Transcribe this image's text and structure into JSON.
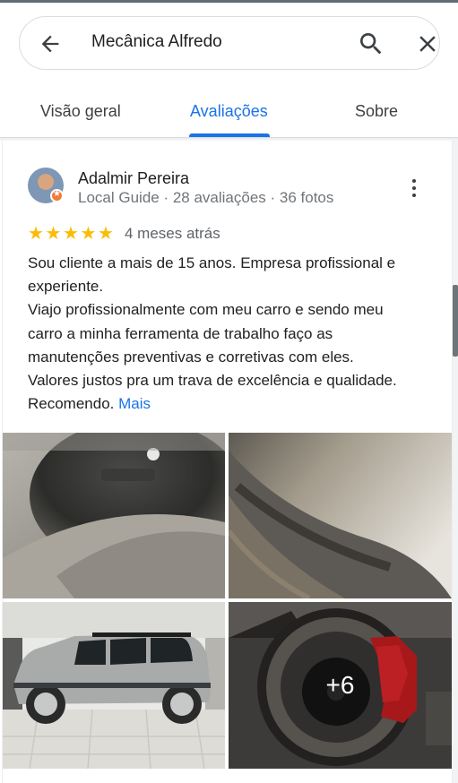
{
  "search": {
    "query": "Mecânica Alfredo",
    "back_icon": "arrow-left-icon",
    "search_icon": "search-icon",
    "close_icon": "close-icon"
  },
  "tabs": [
    {
      "label": "Visão geral",
      "active": false
    },
    {
      "label": "Avaliações",
      "active": true
    },
    {
      "label": "Sobre",
      "active": false
    }
  ],
  "review": {
    "reviewer_name": "Adalmir Pereira",
    "reviewer_meta": "Local Guide · 28 avaliações · 36 fotos",
    "rating": 5,
    "date": "4 meses atrás",
    "text": "Sou cliente a mais de 15 anos. Empresa profissional e\nexperiente.\nViajo profissionalmente com meu carro e sendo meu\ncarro a minha ferramenta de trabalho faço as\nmanutenções preventivas e corretivas com eles.\nValores justos pra um trava de excelência e qualidade.\nRecomendo. ",
    "more_label": "Mais",
    "photos": [
      {
        "subject": "brake-disc-closeup"
      },
      {
        "subject": "rubber-hose-closeup"
      },
      {
        "subject": "silver-suv-in-garage"
      },
      {
        "subject": "red-brake-caliper",
        "overlay": "+6"
      }
    ]
  },
  "colors": {
    "accent": "#1a73e8",
    "star": "#fbbc04",
    "badge": "#f27a36"
  }
}
